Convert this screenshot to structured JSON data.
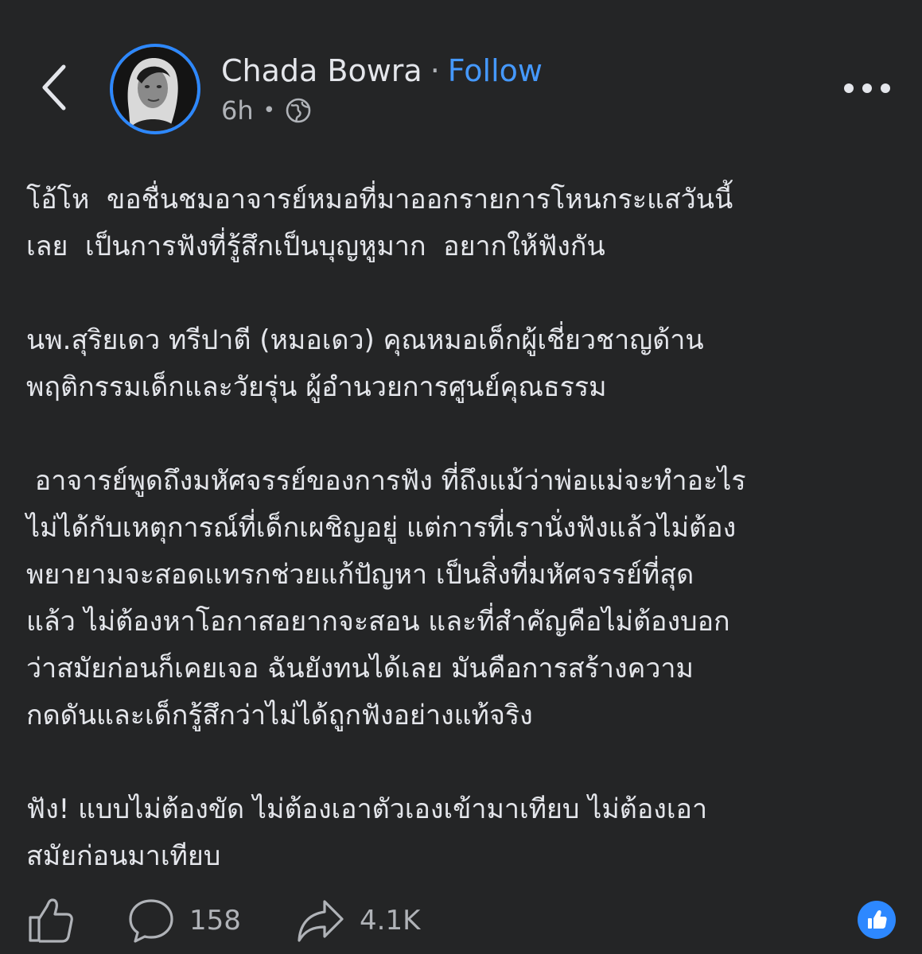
{
  "header": {
    "author_name": "Chada Bowra",
    "separator": "·",
    "follow_label": "Follow",
    "timestamp": "6h",
    "meta_separator": "•",
    "privacy_icon": "globe-icon",
    "back_icon": "chevron-left-icon",
    "more_icon": "more-horizontal-icon"
  },
  "post": {
    "paragraphs": [
      {
        "lines": [
          "โอ้โห  ขอชื่นชมอาจารย์หมอที่มาออกรายการโหนกระแสวันนี้",
          "เลย  เป็นการฟังที่รู้สึกเป็นบุญหูมาก  อยากให้ฟังกัน"
        ]
      },
      {
        "lines": [
          "นพ.สุริยเดว ทรีปาตี (หมอเดว) คุณหมอเด็กผู้เชี่ยวชาญด้าน",
          "พฤติกรรมเด็กและวัยรุ่น ผู้อำนวยการศูนย์คุณธรรม"
        ]
      },
      {
        "lines": [
          " อาจารย์พูดถึงมหัศจรรย์ของการฟัง ที่ถึงแม้ว่าพ่อแม่จะทำอะไร",
          "ไม่ได้กับเหตุการณ์ที่เด็กเผชิญอยู่ แต่การที่เรานั่งฟังแล้วไม่ต้อง",
          "พยายามจะสอดแทรกช่วยแก้ปัญหา เป็นสิ่งที่มหัศจรรย์ที่สุด",
          "แล้ว ไม่ต้องหาโอกาสอยากจะสอน และที่สำคัญคือไม่ต้องบอก",
          "ว่าสมัยก่อนก็เคยเจอ ฉันยังทนได้เลย มันคือการสร้างความ",
          "กดดันและเด็กรู้สึกว่าไม่ได้ถูกฟังอย่างแท้จริง"
        ]
      },
      {
        "lines": [
          "ฟัง! แบบไม่ต้องขัด ไม่ต้องเอาตัวเองเข้ามาเทียบ ไม่ต้องเอา",
          "สมัยก่อนมาเทียบ"
        ]
      }
    ]
  },
  "actions": {
    "like_icon": "thumbs-up-icon",
    "comment_icon": "comment-bubble-icon",
    "comment_count": "158",
    "share_icon": "share-arrow-icon",
    "share_count": "4.1K",
    "reaction_badge_icon": "like-reaction-icon"
  },
  "colors": {
    "background": "#242526",
    "text": "#e4e6eb",
    "secondary_text": "#b0b3b8",
    "accent": "#4599ff",
    "avatar_ring": "#2d88ff"
  }
}
